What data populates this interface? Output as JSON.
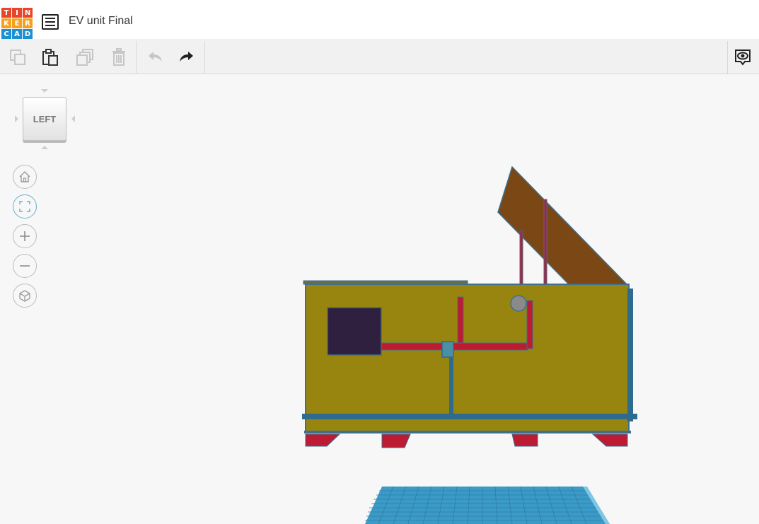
{
  "app": {
    "logo_letters": [
      "T",
      "I",
      "N",
      "K",
      "E",
      "R",
      "C",
      "A",
      "D"
    ],
    "logo_colors": [
      "#e8462b",
      "#e8462b",
      "#e8462b",
      "#f4a11d",
      "#f4a11d",
      "#f4a11d",
      "#1f8fd4",
      "#1f8fd4",
      "#1f8fd4"
    ],
    "design_title": "EV unit Final"
  },
  "toolbar": {
    "items": [
      {
        "icon": "copy-icon",
        "enabled": false
      },
      {
        "icon": "paste-icon",
        "enabled": true
      },
      {
        "icon": "duplicate-icon",
        "enabled": false
      },
      {
        "icon": "trash-icon",
        "enabled": false
      },
      {
        "icon": "undo-icon",
        "enabled": false
      },
      {
        "icon": "redo-icon",
        "enabled": true
      }
    ],
    "right_icon": "eye-notes-icon"
  },
  "view": {
    "cube_label": "LEFT",
    "nav_buttons": [
      "home-view-icon",
      "fit-all-icon",
      "zoom-in-icon",
      "zoom-out-icon",
      "perspective-icon"
    ]
  },
  "colors": {
    "body": "#978510",
    "body_edge": "#3e6f8c",
    "red_parts": "#bd1b33",
    "lid": "#7b4714",
    "screen": "#30203f",
    "workplane": "#3c9ac6"
  }
}
